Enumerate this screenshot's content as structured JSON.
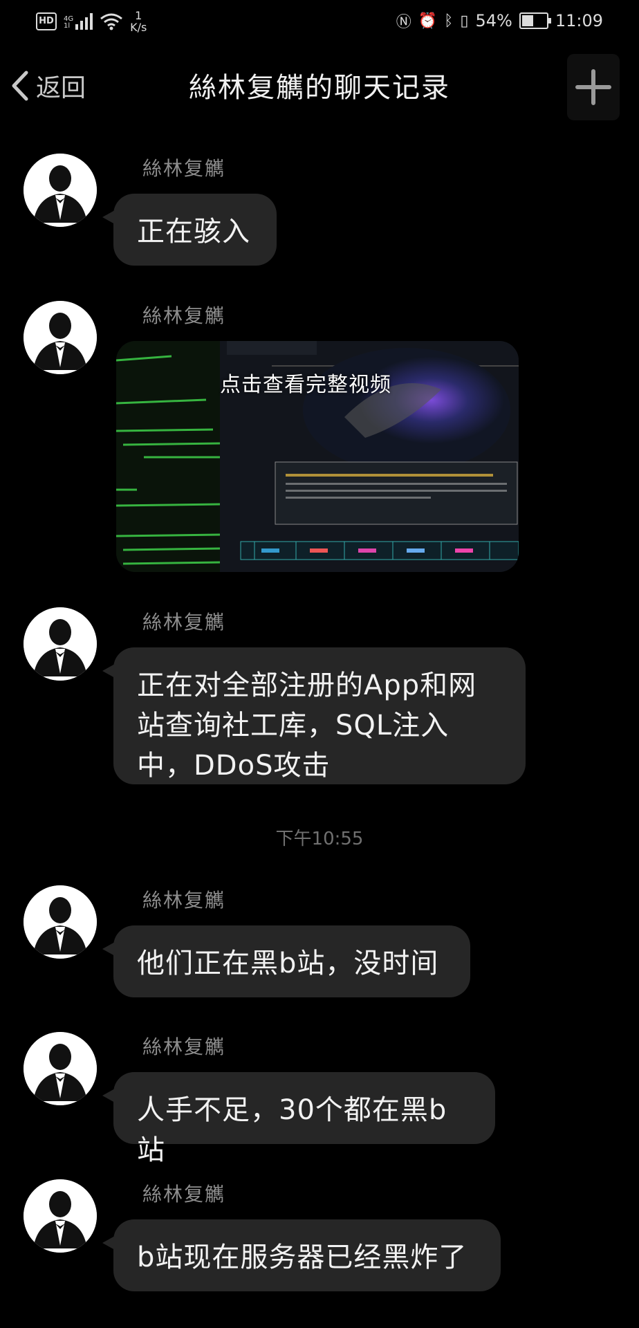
{
  "status_bar": {
    "hd": "HD",
    "network": "4G",
    "network_sub": "1l",
    "speed_value": "1",
    "speed_unit": "K/s",
    "battery": "54%",
    "battery_level": 0.54,
    "time": "11:09"
  },
  "header": {
    "back_label": "返回",
    "title": "絲林复觽的聊天记录"
  },
  "messages": [
    {
      "sender": "絲林复觽",
      "text": "正在骇入"
    },
    {
      "sender": "絲林复觽",
      "media_caption": "点击查看完整视频"
    },
    {
      "sender": "絲林复觽",
      "lines": [
        "正在对全部注册的App和网",
        "站查询社工库，SQL注入",
        "中，DDoS攻击"
      ]
    },
    {
      "sender": "絲林复觽",
      "text": "他们正在黑b站，没时间"
    },
    {
      "sender": "絲林复觽",
      "text": "人手不足，30个都在黑b站"
    },
    {
      "sender": "絲林复觽",
      "text": "b站现在服务器已经黑炸了"
    }
  ],
  "timestamp": "下午10:55"
}
